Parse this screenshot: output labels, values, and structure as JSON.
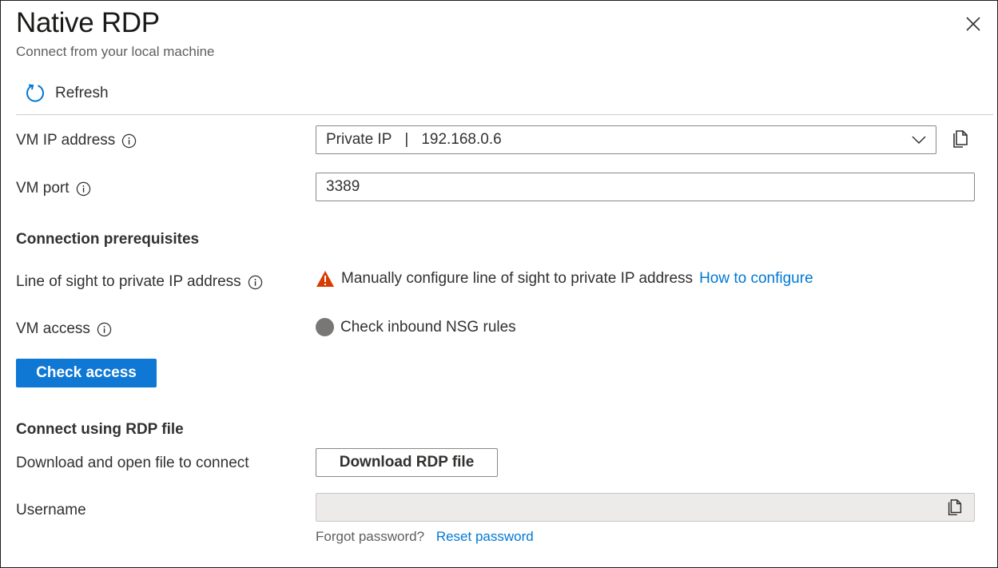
{
  "header": {
    "title": "Native RDP",
    "subtitle": "Connect from your local machine"
  },
  "toolbar": {
    "refresh_label": "Refresh"
  },
  "fields": {
    "ip_label": "VM IP address",
    "ip_type": "Private IP",
    "ip_separator": "|",
    "ip_value": "192.168.0.6",
    "port_label": "VM port",
    "port_value": "3389"
  },
  "prerequisites": {
    "heading": "Connection prerequisites",
    "line_of_sight_label": "Line of sight to private IP address",
    "line_of_sight_status": "Manually configure line of sight to private IP address",
    "line_of_sight_link": "How to configure",
    "vm_access_label": "VM access",
    "vm_access_status": "Check inbound NSG rules",
    "check_access_button": "Check access"
  },
  "rdp_file": {
    "heading": "Connect using RDP file",
    "download_label": "Download and open file to connect",
    "download_button": "Download RDP file",
    "username_label": "Username",
    "username_value": "",
    "forgot_text": "Forgot password?",
    "reset_link": "Reset password"
  },
  "icons": {
    "close": "close-icon",
    "refresh": "refresh-icon",
    "info": "info-icon",
    "chevron": "chevron-down-icon",
    "copy": "copy-icon",
    "warning": "warning-icon",
    "status_unknown": "status-circle-icon"
  },
  "colors": {
    "accent": "#0078d4",
    "warning": "#d83b01",
    "status_grey": "#797775"
  }
}
